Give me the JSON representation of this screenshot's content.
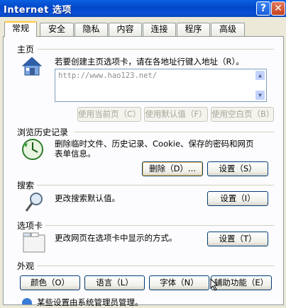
{
  "window": {
    "title": "Internet 选项",
    "help_glyph": "?",
    "close_glyph": "✕"
  },
  "tabs": [
    "常规",
    "安全",
    "隐私",
    "内容",
    "连接",
    "程序",
    "高级"
  ],
  "home": {
    "title": "主页",
    "description": "若要创建主页选项卡，请在各地址行键入地址（R）。",
    "url": "http://www.hao123.net/",
    "buttons": [
      "使用当前页（C）",
      "使用默认值（F）",
      "使用空白页（B）"
    ]
  },
  "history": {
    "title": "浏览历史记录",
    "description_line1": "删除临时文件、历史记录、Cookie、保存的密码和网页",
    "description_line2": "表单信息。",
    "delete_label": "删除（D）...",
    "settings_label": "设置（S）"
  },
  "search": {
    "title": "搜索",
    "description": "更改搜索默认值。",
    "settings_label": "设置（I）"
  },
  "tabs_section": {
    "title": "选项卡",
    "description": "更改网页在选项卡中显示的方式。",
    "settings_label": "设置（T）"
  },
  "appearance": {
    "title": "外观",
    "buttons": [
      "颜色（O）",
      "语言（L）",
      "字体（N）",
      "辅助功能（E）"
    ]
  },
  "footer": {
    "text": "某些设置由系统管理员管理。"
  },
  "colors": {
    "titlebar": "#0347c9",
    "dialog_bg": "#ece9d8",
    "tab_highlight": "#ffc83c"
  }
}
